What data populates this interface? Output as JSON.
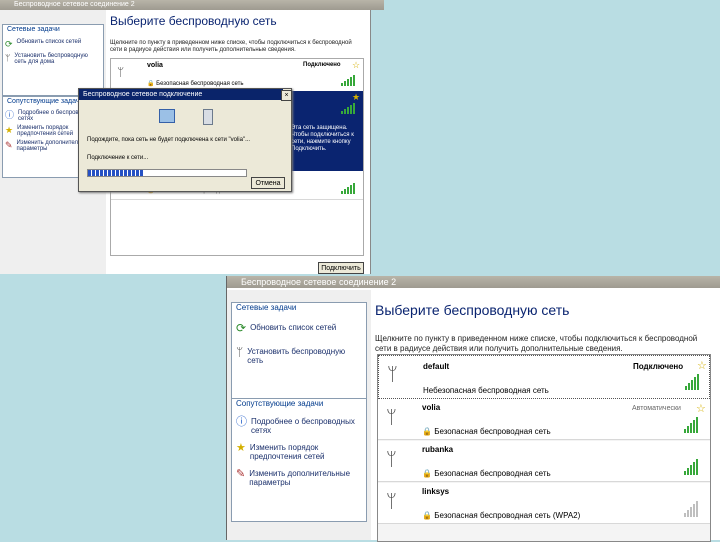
{
  "back": {
    "title": "Беспроводное сетевое соединение 2",
    "network_tasks_header": "Сетевые задачи",
    "refresh": "Обновить список сетей",
    "setup": "Установить беспроводную сеть для дома",
    "related_header": "Сопутствующие задачи",
    "about": "Подробнее о беспроводных сетях",
    "order": "Изменить порядок предпочтения сетей",
    "advanced": "Изменить дополнительные параметры",
    "heading": "Выберите беспроводную сеть",
    "description": "Щелкните по пункту в приведенном ниже списке, чтобы подключиться к беспроводной сети в радиусе действия или получить дополнительные сведения.",
    "networks": [
      {
        "name": "volia",
        "status": "Подключено",
        "security": "Безопасная беспроводная сеть"
      },
      {
        "name": "",
        "status": "",
        "security": "Безопасная беспроводная сеть"
      }
    ],
    "selected_text": "Эта сеть защищена. Чтобы подключиться к сети, нажмите кнопку Подключить.",
    "connect_button": "Подключить"
  },
  "dialog": {
    "title": "Беспроводное сетевое подключение",
    "message": "Подождите, пока сеть не будет подключена к сети \"volia\"...",
    "progress_label": "Подключение к сети...",
    "progress": 0.35,
    "cancel": "Отмена"
  },
  "front": {
    "title": "Беспроводное сетевое соединение 2",
    "network_tasks_header": "Сетевые задачи",
    "refresh": "Обновить список сетей",
    "setup": "Установить беспроводную сеть",
    "related_header": "Сопутствующие задачи",
    "about": "Подробнее о беспроводных сетях",
    "order": "Изменить порядок предпочтения сетей",
    "advanced": "Изменить дополнительные параметры",
    "heading": "Выберите беспроводную сеть",
    "description": "Щелкните по пункту в приведенном ниже списке, чтобы подключиться к беспроводной сети в радиусе действия или получить дополнительные сведения.",
    "networks": [
      {
        "name": "default",
        "status": "Подключено",
        "security": "Небезопасная беспроводная сеть",
        "signal": 5
      },
      {
        "name": "volia",
        "status": "Автоматически",
        "security": "Безопасная беспроводная сеть",
        "signal": 4
      },
      {
        "name": "rubanka",
        "status": "",
        "security": "Безопасная беспроводная сеть",
        "signal": 4
      },
      {
        "name": "linksys",
        "status": "",
        "security": "Безопасная беспроводная сеть (WPA2)",
        "signal": 4
      }
    ]
  },
  "colors": {
    "accent": "#0a2470",
    "signal": "#37a83a",
    "star": "#d4b000"
  }
}
